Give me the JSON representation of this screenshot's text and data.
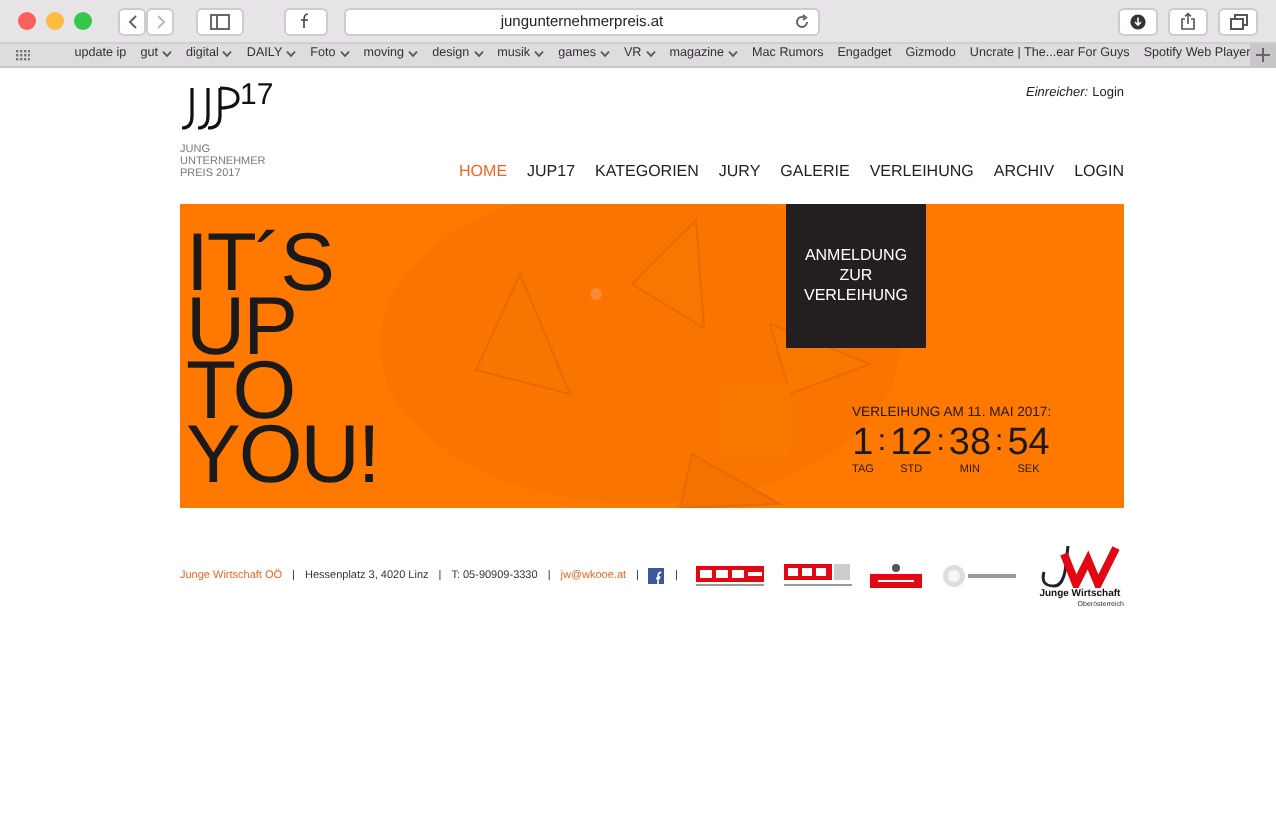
{
  "browser": {
    "url": "jungunternehmerpreis.at",
    "bookmarks": [
      {
        "label": "update ip",
        "kind": "link"
      },
      {
        "label": "gut",
        "kind": "folder"
      },
      {
        "label": "digital",
        "kind": "folder"
      },
      {
        "label": "DAILY",
        "kind": "folder"
      },
      {
        "label": "Foto",
        "kind": "folder"
      },
      {
        "label": "moving",
        "kind": "folder"
      },
      {
        "label": "design",
        "kind": "folder"
      },
      {
        "label": "musik",
        "kind": "folder"
      },
      {
        "label": "games",
        "kind": "folder"
      },
      {
        "label": "VR",
        "kind": "folder"
      },
      {
        "label": "magazine",
        "kind": "folder"
      },
      {
        "label": "Mac Rumors",
        "kind": "link"
      },
      {
        "label": "Engadget",
        "kind": "link"
      },
      {
        "label": "Gizmodo",
        "kind": "link"
      },
      {
        "label": "Uncrate | The...ear For Guys",
        "kind": "link"
      },
      {
        "label": "Spotify Web Player",
        "kind": "link"
      }
    ]
  },
  "header": {
    "logo_number": "17",
    "logo_lines": [
      "JUNG",
      "UNTERNEHMER",
      "PREIS 2017"
    ],
    "submitter_label": "Einreicher:",
    "submitter_link": "Login"
  },
  "nav": [
    {
      "label": "HOME",
      "selected": true
    },
    {
      "label": "JUP17",
      "selected": false
    },
    {
      "label": "KATEGORIEN",
      "selected": false
    },
    {
      "label": "JURY",
      "selected": false
    },
    {
      "label": "GALERIE",
      "selected": false
    },
    {
      "label": "VERLEIHUNG",
      "selected": false
    },
    {
      "label": "ARCHIV",
      "selected": false
    },
    {
      "label": "LOGIN",
      "selected": false
    }
  ],
  "hero": {
    "headline": [
      "IT´S",
      "UP",
      "TO",
      "YOU!"
    ],
    "cta": [
      "ANMELDUNG",
      "ZUR",
      "VERLEIHUNG"
    ],
    "countdown_title": "VERLEIHUNG AM 11. MAI 2017:",
    "countdown": [
      {
        "value": "1",
        "unit": "TAG"
      },
      {
        "value": "12",
        "unit": "STD"
      },
      {
        "value": "38",
        "unit": "MIN"
      },
      {
        "value": "54",
        "unit": "SEK"
      }
    ],
    "separator": ":"
  },
  "footer": {
    "items": [
      {
        "text": "Junge Wirtschaft OÖ",
        "kind": "accent"
      },
      {
        "text": "Hessenplatz 3, 4020 Linz",
        "kind": "plain"
      },
      {
        "text": "T: 05-90909-3330",
        "kind": "plain"
      },
      {
        "text": "jw@wkooe.at",
        "kind": "accent"
      }
    ],
    "divider": "|",
    "jw_name": "Junge Wirtschaft",
    "jw_region": "Oberösterreich"
  }
}
